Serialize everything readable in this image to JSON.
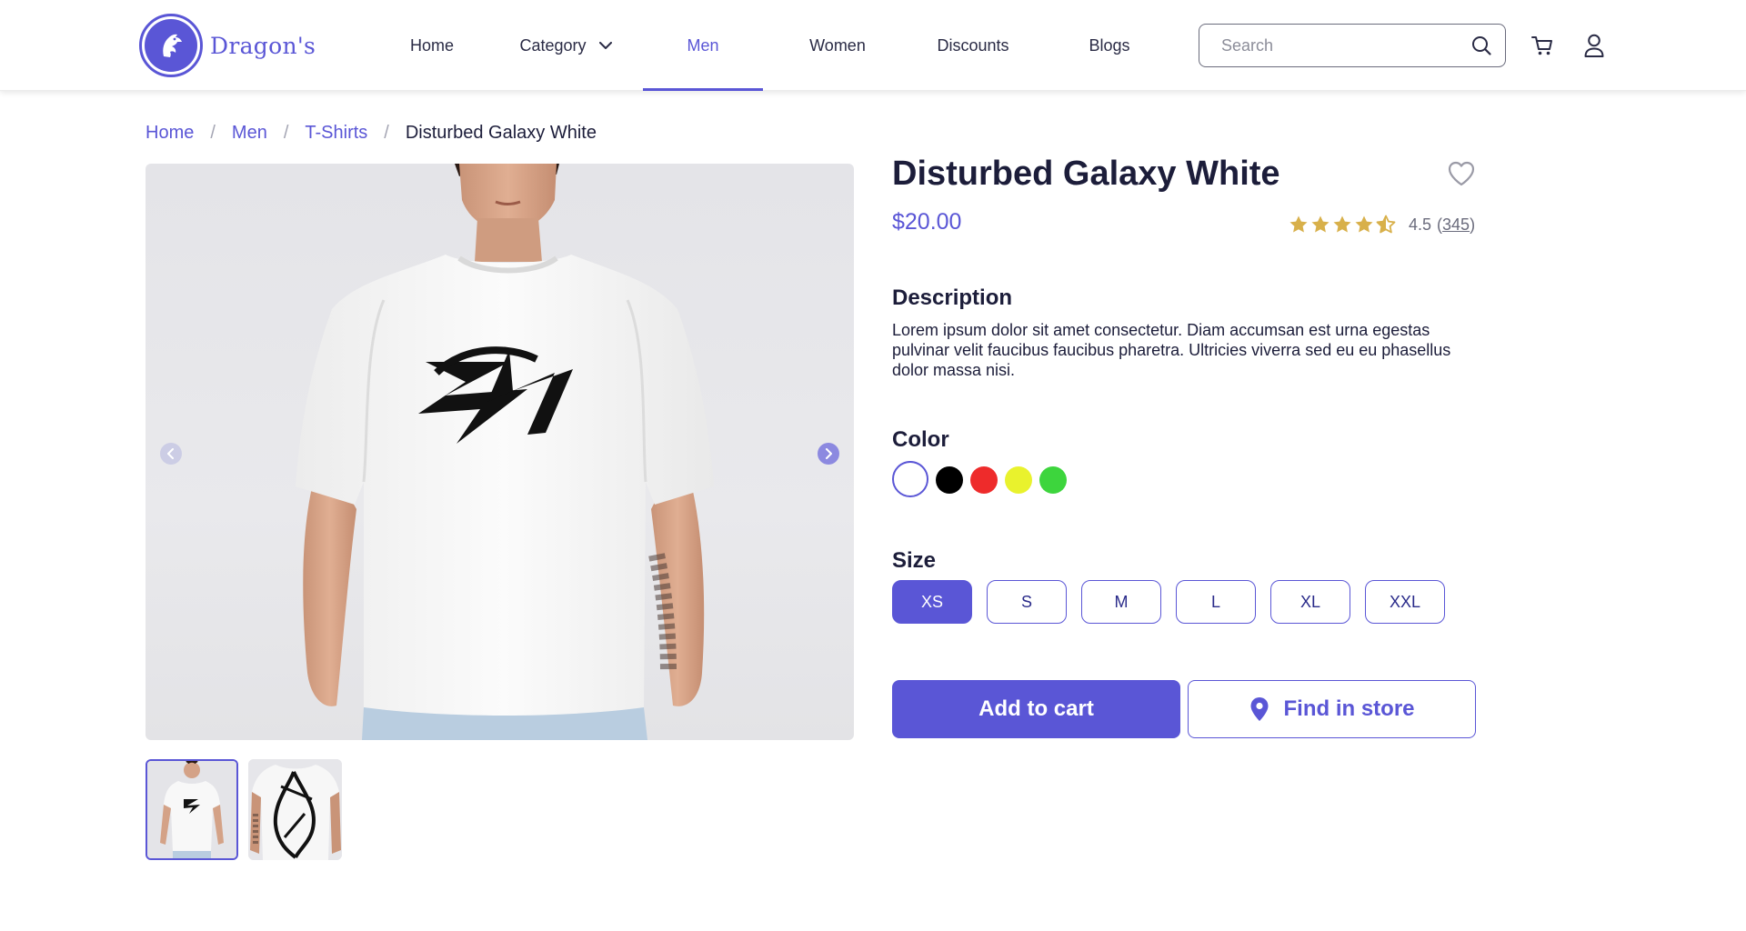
{
  "brand": {
    "name": "Dragon's",
    "accent": "#5a56d6"
  },
  "nav": {
    "items": [
      {
        "label": "Home"
      },
      {
        "label": "Category"
      },
      {
        "label": "Men",
        "active": true
      },
      {
        "label": "Women"
      },
      {
        "label": "Discounts"
      },
      {
        "label": "Blogs"
      }
    ]
  },
  "search": {
    "placeholder": "Search",
    "value": ""
  },
  "header_icons": [
    "search-icon",
    "cart-icon",
    "user-icon"
  ],
  "breadcrumb": {
    "items": [
      "Home",
      "Men",
      "T-Shirts"
    ],
    "current": "Disturbed Galaxy White",
    "separator": "/"
  },
  "product": {
    "title": "Disturbed Galaxy White",
    "price": "$20.00",
    "rating": {
      "value": "4.5",
      "count": "345",
      "stars": 4.5
    },
    "description_label": "Description",
    "description": "Lorem ipsum dolor sit amet consectetur. Diam accumsan est urna egestas pulvinar velit faucibus faucibus pharetra. Ultricies viverra sed eu eu phasellus dolor massa nisi.",
    "color_label": "Color",
    "colors": [
      "#ffffff",
      "#000000",
      "#ee2b2b",
      "#e9f22d",
      "#3dd53d"
    ],
    "selected_color": "#ffffff",
    "size_label": "Size",
    "sizes": [
      "XS",
      "S",
      "M",
      "L",
      "XL",
      "XXL"
    ],
    "selected_size": "XS",
    "add_to_cart": "Add to cart",
    "find_in_store": "Find in store"
  },
  "gallery": {
    "thumbnails": 2,
    "selected": 0
  },
  "colors": {
    "accent": "#5a56d6",
    "star": "#d8b04a",
    "text": "#1c1d3a"
  }
}
